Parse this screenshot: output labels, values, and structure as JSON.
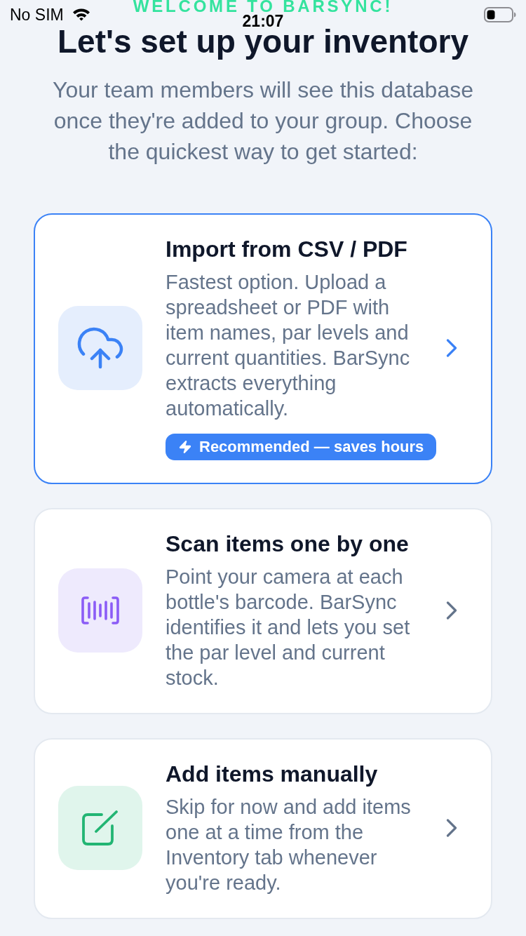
{
  "status_bar": {
    "carrier": "No SIM",
    "time": "21:07"
  },
  "welcome": "WELCOME TO BARSYNC!",
  "title": "Let's set up your inventory",
  "subtitle": "Your team members will see this database once they're added to your group. Choose the quickest way to get started:",
  "options": [
    {
      "kind": "import",
      "title": "Import from CSV / PDF",
      "description": "Fastest option. Upload a spreadsheet or PDF with item names, par levels and current quantities. BarSync extracts everything automatically.",
      "badge": "Recommended — saves hours",
      "selected": true
    },
    {
      "kind": "scan",
      "title": "Scan items one by one",
      "description": "Point your camera at each bottle's barcode. BarSync identifies it and lets you set the par level and current stock.",
      "selected": false
    },
    {
      "kind": "manual",
      "title": "Add items manually",
      "description": "Skip for now and add items one at a time from the Inventory tab whenever you're ready.",
      "selected": false
    }
  ]
}
